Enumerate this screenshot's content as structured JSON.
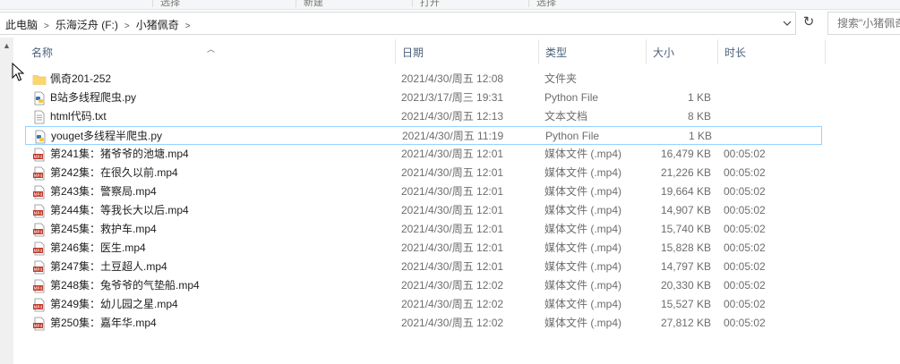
{
  "ribbon": {
    "tabs": [
      "选择",
      "新建",
      "打开",
      "选择"
    ]
  },
  "address": {
    "breadcrumbs": [
      "此电脑",
      "乐海泛舟 (F:)",
      "小猪佩奇"
    ]
  },
  "search": {
    "placeholder": "搜索\"小猪佩奇\""
  },
  "columns": {
    "name": "名称",
    "date": "日期",
    "type": "类型",
    "size": "大小",
    "duration": "时长"
  },
  "files": [
    {
      "icon": "folder-icon",
      "name": "佩奇201-252",
      "date": "2021/4/30/周五 12:08",
      "type": "文件夹",
      "size": "",
      "duration": ""
    },
    {
      "icon": "python-file-icon",
      "name": "B站多线程爬虫.py",
      "date": "2021/3/17/周三 19:31",
      "type": "Python File",
      "size": "1 KB",
      "duration": ""
    },
    {
      "icon": "text-file-icon",
      "name": "html代码.txt",
      "date": "2021/4/30/周五 12:13",
      "type": "文本文档",
      "size": "8 KB",
      "duration": ""
    },
    {
      "icon": "python-file-icon",
      "name": "youget多线程半爬虫.py",
      "date": "2021/4/30/周五 11:19",
      "type": "Python File",
      "size": "1 KB",
      "duration": "",
      "selected": true
    },
    {
      "icon": "mp4-file-icon",
      "name": "第241集：猪爷爷的池塘.mp4",
      "date": "2021/4/30/周五 12:01",
      "type": "媒体文件 (.mp4)",
      "size": "16,479 KB",
      "duration": "00:05:02"
    },
    {
      "icon": "mp4-file-icon",
      "name": "第242集：在很久以前.mp4",
      "date": "2021/4/30/周五 12:01",
      "type": "媒体文件 (.mp4)",
      "size": "21,226 KB",
      "duration": "00:05:02"
    },
    {
      "icon": "mp4-file-icon",
      "name": "第243集：警察局.mp4",
      "date": "2021/4/30/周五 12:01",
      "type": "媒体文件 (.mp4)",
      "size": "19,664 KB",
      "duration": "00:05:02"
    },
    {
      "icon": "mp4-file-icon",
      "name": "第244集：等我长大以后.mp4",
      "date": "2021/4/30/周五 12:01",
      "type": "媒体文件 (.mp4)",
      "size": "14,907 KB",
      "duration": "00:05:02"
    },
    {
      "icon": "mp4-file-icon",
      "name": "第245集：救护车.mp4",
      "date": "2021/4/30/周五 12:01",
      "type": "媒体文件 (.mp4)",
      "size": "15,740 KB",
      "duration": "00:05:02"
    },
    {
      "icon": "mp4-file-icon",
      "name": "第246集：医生.mp4",
      "date": "2021/4/30/周五 12:01",
      "type": "媒体文件 (.mp4)",
      "size": "15,828 KB",
      "duration": "00:05:02"
    },
    {
      "icon": "mp4-file-icon",
      "name": "第247集：土豆超人.mp4",
      "date": "2021/4/30/周五 12:01",
      "type": "媒体文件 (.mp4)",
      "size": "14,797 KB",
      "duration": "00:05:02"
    },
    {
      "icon": "mp4-file-icon",
      "name": "第248集：兔爷爷的气垫船.mp4",
      "date": "2021/4/30/周五 12:02",
      "type": "媒体文件 (.mp4)",
      "size": "20,330 KB",
      "duration": "00:05:02"
    },
    {
      "icon": "mp4-file-icon",
      "name": "第249集：幼儿园之星.mp4",
      "date": "2021/4/30/周五 12:02",
      "type": "媒体文件 (.mp4)",
      "size": "15,527 KB",
      "duration": "00:05:02"
    },
    {
      "icon": "mp4-file-icon",
      "name": "第250集：嘉年华.mp4",
      "date": "2021/4/30/周五 12:02",
      "type": "媒体文件 (.mp4)",
      "size": "27,812 KB",
      "duration": "00:05:02"
    }
  ]
}
